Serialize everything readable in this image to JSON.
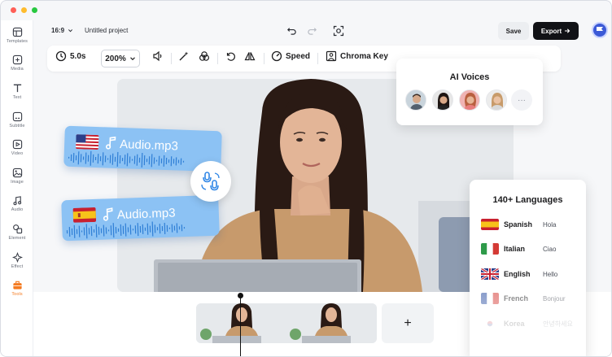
{
  "topbar": {
    "aspect_ratio": "16:9",
    "project_name": "Untitled project",
    "save_label": "Save",
    "export_label": "Export"
  },
  "sidebar": {
    "items": [
      {
        "label": "Templates",
        "icon": "templates-icon"
      },
      {
        "label": "Media",
        "icon": "media-icon"
      },
      {
        "label": "Text",
        "icon": "text-icon"
      },
      {
        "label": "Subtitle",
        "icon": "subtitle-icon"
      },
      {
        "label": "Video",
        "icon": "video-icon"
      },
      {
        "label": "Image",
        "icon": "image-icon"
      },
      {
        "label": "Audio",
        "icon": "audio-icon"
      },
      {
        "label": "Element",
        "icon": "element-icon"
      },
      {
        "label": "Effect",
        "icon": "effect-icon"
      },
      {
        "label": "Tools",
        "icon": "tools-icon",
        "active": true
      }
    ]
  },
  "toolbar": {
    "duration": "5.0s",
    "zoom": "200%",
    "speed_label": "Speed",
    "chroma_label": "Chroma Key"
  },
  "audio_cards": [
    {
      "file": "Audio.mp3",
      "flag": "us"
    },
    {
      "file": "Audio.mp3",
      "flag": "es"
    }
  ],
  "ai_voices": {
    "title": "AI Voices",
    "more": "···"
  },
  "languages": {
    "title": "140+ Languages",
    "rows": [
      {
        "name": "Spanish",
        "hello": "Hola"
      },
      {
        "name": "Italian",
        "hello": "Ciao"
      },
      {
        "name": "English",
        "hello": "Hello"
      },
      {
        "name": "French",
        "hello": "Bonjour"
      },
      {
        "name": "Korea",
        "hello": "안녕하세요"
      }
    ]
  },
  "timeline": {
    "add_label": "+"
  },
  "colors": {
    "accent": "#f47a1f",
    "export_bg": "#111216",
    "audio_card": "#8cc2f4"
  }
}
